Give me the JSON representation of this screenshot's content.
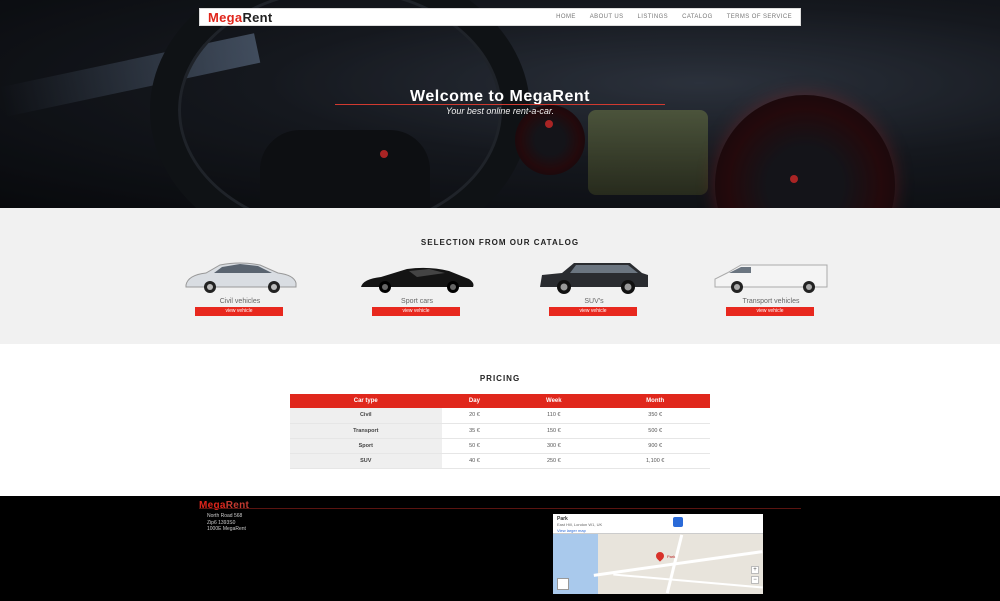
{
  "brand": {
    "part1": "Mega",
    "part2": "Rent"
  },
  "nav": [
    "HOME",
    "ABOUT US",
    "LISTINGS",
    "CATALOG",
    "TERMS OF SERVICE"
  ],
  "hero": {
    "title": "Welcome to MegaRent",
    "subtitle": "Your best online rent-a-car."
  },
  "catalog": {
    "title": "SELECTION FROM OUR CATALOG",
    "items": [
      {
        "label": "Civil vehicles",
        "button": "view vehicle"
      },
      {
        "label": "Sport cars",
        "button": "view vehicle"
      },
      {
        "label": "SUV's",
        "button": "view vehicle"
      },
      {
        "label": "Transport vehicles",
        "button": "view vehicle"
      }
    ]
  },
  "pricing": {
    "title": "PRICING",
    "headers": [
      "Car type",
      "Day",
      "Week",
      "Month"
    ],
    "rows": [
      [
        "Civil",
        "20 €",
        "110 €",
        "350 €"
      ],
      [
        "Transport",
        "35 €",
        "150 €",
        "500 €"
      ],
      [
        "Sport",
        "50 €",
        "300 €",
        "900 €"
      ],
      [
        "SUV",
        "40 €",
        "250 €",
        "1,100 €"
      ]
    ]
  },
  "footer": {
    "address": [
      "North Road 568",
      "Zip6 1393S0",
      "1000E MegaRent"
    ],
    "map": {
      "title": "Park",
      "subtitle": "East Hill, London W1, UK",
      "link": "View larger map",
      "pin": "Park"
    }
  }
}
